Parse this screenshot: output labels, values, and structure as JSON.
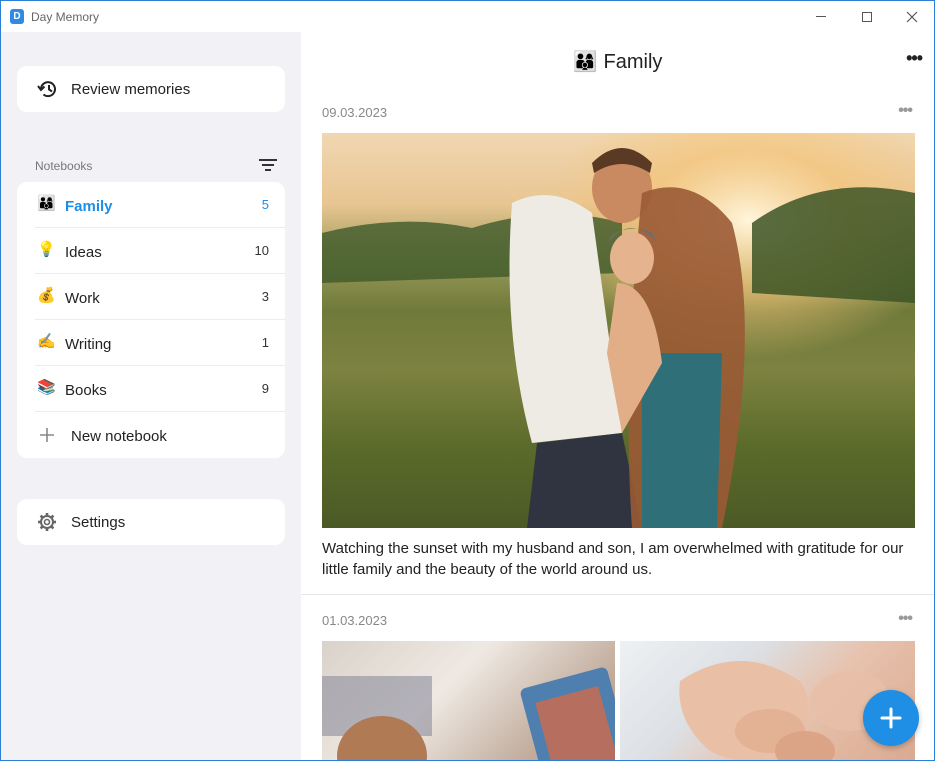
{
  "window": {
    "app_icon_letter": "D",
    "title": "Day Memory"
  },
  "sidebar": {
    "review_label": "Review memories",
    "notebooks_header": "Notebooks",
    "notebooks": [
      {
        "emoji": "👨‍👩‍👦",
        "name": "Family",
        "count": "5",
        "active": true
      },
      {
        "emoji": "💡",
        "name": "Ideas",
        "count": "10",
        "active": false
      },
      {
        "emoji": "💰",
        "name": "Work",
        "count": "3",
        "active": false
      },
      {
        "emoji": "✍️",
        "name": "Writing",
        "count": "1",
        "active": false
      },
      {
        "emoji": "📚",
        "name": "Books",
        "count": "9",
        "active": false
      }
    ],
    "new_notebook_label": "New notebook",
    "settings_label": "Settings"
  },
  "main": {
    "title_emoji": "👨‍👩‍👦",
    "title": "Family",
    "more_glyph": "•••",
    "entries": [
      {
        "date": "09.03.2023",
        "more_glyph": "•••",
        "text": "Watching the sunset with my husband and son, I am overwhelmed with gratitude for our little family and the beauty of the world around us."
      },
      {
        "date": "01.03.2023",
        "more_glyph": "•••"
      }
    ],
    "fab_glyph": "+"
  },
  "colors": {
    "accent": "#1f8ee5",
    "sidebar_bg": "#f2f2f6",
    "window_border": "#2b7fd6"
  }
}
